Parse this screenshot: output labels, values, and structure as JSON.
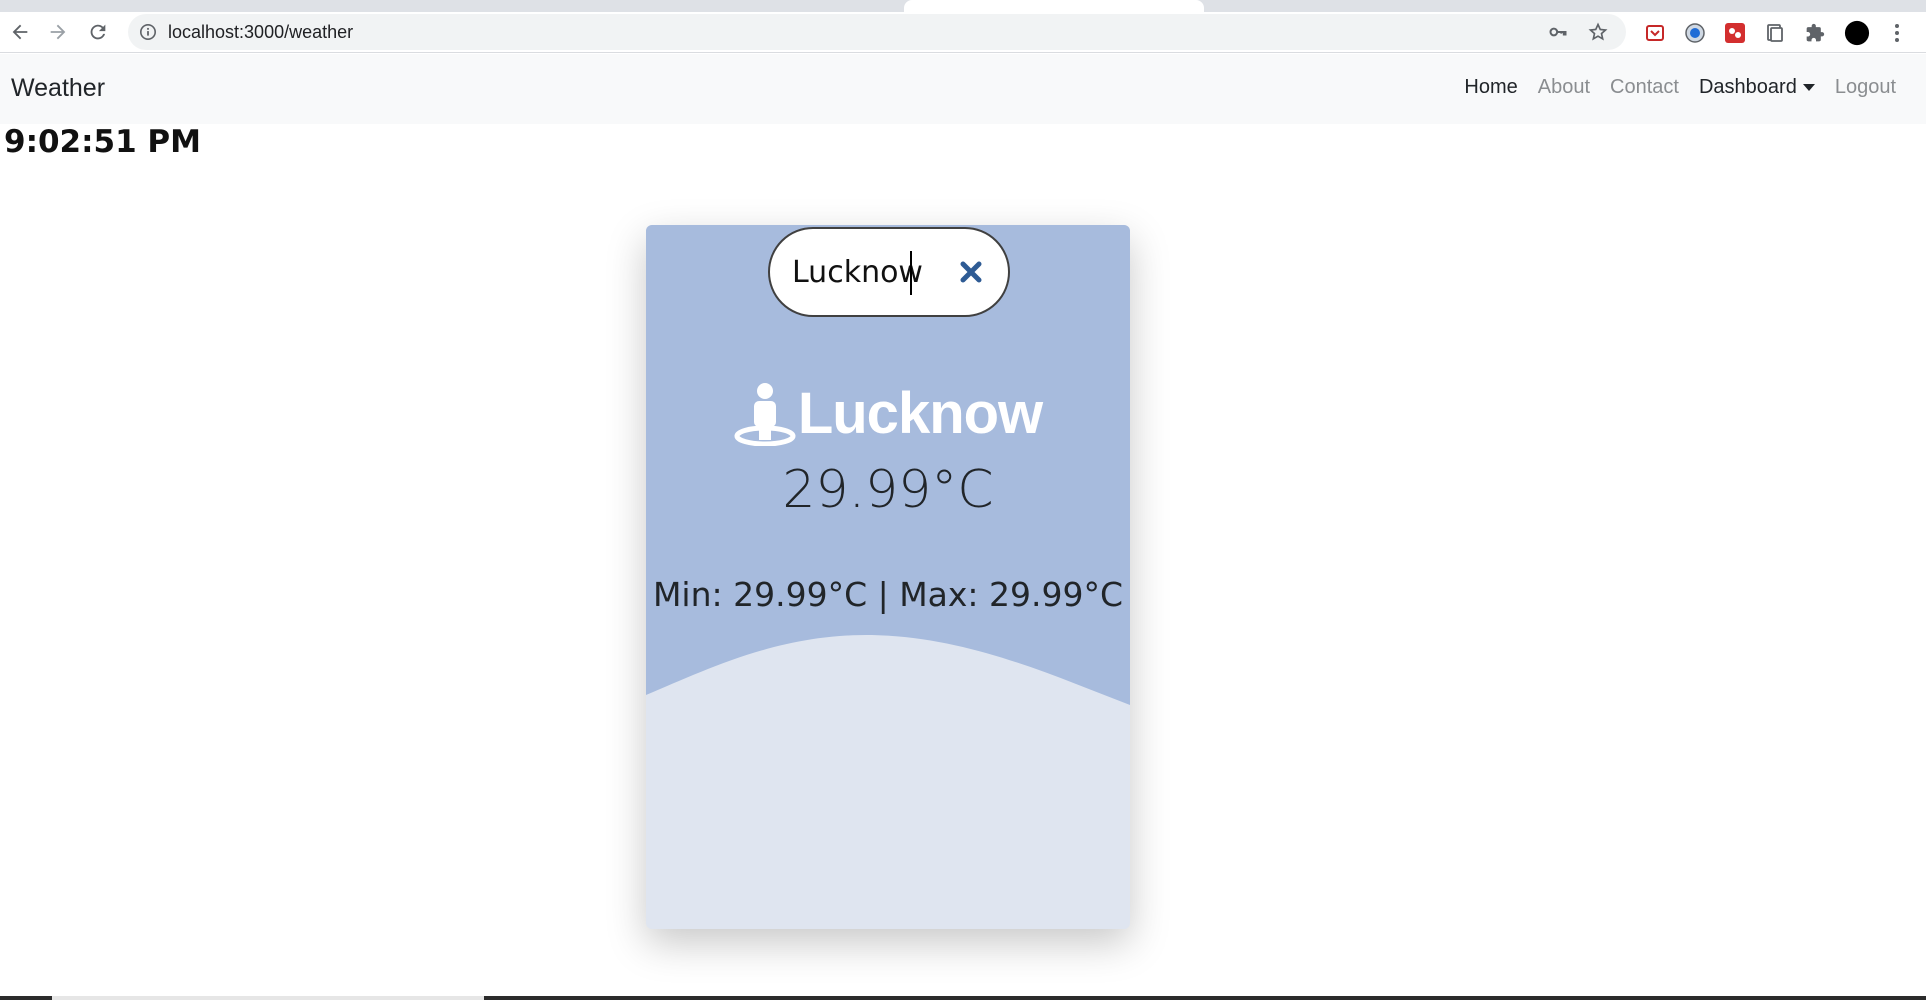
{
  "browser": {
    "url": "localhost:3000/weather",
    "icons": [
      "back-icon",
      "forward-icon",
      "reload-icon",
      "info-icon",
      "key-icon",
      "star-icon",
      "pocket-icon",
      "extension-blue-icon",
      "extension-red-icon",
      "extension-doc-icon",
      "puzzle-icon",
      "profile-avatar",
      "menu-dots-icon"
    ]
  },
  "navbar": {
    "brand": "Weather",
    "links": {
      "home": "Home",
      "about": "About",
      "contact": "Contact",
      "dashboard": "Dashboard",
      "logout": "Logout"
    }
  },
  "clock": "9:02:51 PM",
  "weather": {
    "search_value": "Lucknow",
    "city": "Lucknow",
    "temperature": "29.99°C",
    "min_max": "Min: 29.99°C | Max: 29.99°C"
  },
  "colors": {
    "card_top": "#a7bbdd",
    "card_bottom": "#dfe5f0",
    "clear_icon": "#2e5b94",
    "navbar_bg": "#f8f9fa"
  }
}
